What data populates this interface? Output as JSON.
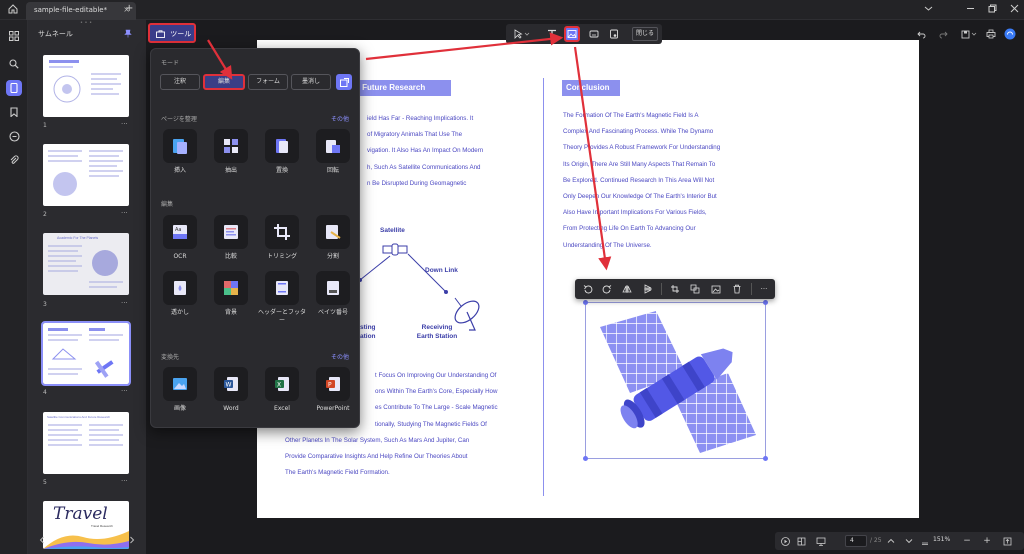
{
  "app": {
    "tab_title": "sample-file-editable*",
    "tab_close": "×",
    "new_tab": "+"
  },
  "thumbnails": {
    "panel_title": "サムネール",
    "pages": [
      {
        "num": "1",
        "more": "···"
      },
      {
        "num": "2",
        "more": "···"
      },
      {
        "num": "3",
        "more": "···"
      },
      {
        "num": "4",
        "more": "···"
      },
      {
        "num": "5",
        "more": "···"
      }
    ],
    "thumb_titles": {
      "p3": "Academic For The Planets",
      "p5": "Satellite Communications And Future Research",
      "p6_big": "Travel",
      "p6_sub": "Travel Research"
    }
  },
  "toolbar": {
    "tools_label": "ツール",
    "close_label": "閉じる"
  },
  "popup": {
    "mode": {
      "title": "モード",
      "buttons": [
        {
          "label": "注釈",
          "active": false
        },
        {
          "label": "編集",
          "active": true
        },
        {
          "label": "フォーム",
          "active": false
        },
        {
          "label": "墨消し",
          "active": false
        }
      ]
    },
    "organize": {
      "title": "ページを整理",
      "more": "その他",
      "items": [
        {
          "label": "挿入",
          "icon": "insert-pages-icon"
        },
        {
          "label": "抽出",
          "icon": "extract-pages-icon"
        },
        {
          "label": "置換",
          "icon": "replace-pages-icon"
        },
        {
          "label": "回転",
          "icon": "rotate-pages-icon"
        }
      ]
    },
    "edit": {
      "title": "編集",
      "items": [
        {
          "label": "OCR",
          "icon": "ocr-icon"
        },
        {
          "label": "比較",
          "icon": "compare-icon"
        },
        {
          "label": "トリミング",
          "icon": "crop-icon"
        },
        {
          "label": "分割",
          "icon": "split-icon"
        },
        {
          "label": "透かし",
          "icon": "watermark-icon"
        },
        {
          "label": "背景",
          "icon": "background-icon"
        },
        {
          "label": "ヘッダーとフッター",
          "icon": "header-footer-icon"
        },
        {
          "label": "ベイツ番号",
          "icon": "bates-number-icon"
        }
      ]
    },
    "convert": {
      "title": "変換先",
      "more": "その他",
      "items": [
        {
          "label": "画像",
          "icon": "image-icon",
          "color": "#4aa3f0"
        },
        {
          "label": "Word",
          "icon": "word-icon",
          "color": "#2b579a"
        },
        {
          "label": "Excel",
          "icon": "excel-icon",
          "color": "#217346"
        },
        {
          "label": "PowerPoint",
          "icon": "powerpoint-icon",
          "color": "#d24726"
        }
      ]
    }
  },
  "document": {
    "left_heading": "d Future Research",
    "left_top_lines": [
      "ield Has Far - Reaching Implications. It",
      "of Migratory Animals That Use The",
      "vigation. It Also Has An Impact On Modern",
      "h, Such As Satellite Communications And",
      "n Be Disrupted During Geomagnetic"
    ],
    "diagram": {
      "satellite": "Satellite",
      "downlink": "Down Link",
      "left_a": "sting",
      "left_b": "ation",
      "receiving_a": "Receiving",
      "receiving_b": "Earth Station"
    },
    "left_bottom_lines": [
      "t Focus On Improving Our Understanding Of",
      "ons Within The Earth's Core, Especially How",
      "es Contribute To The Large - Scale Magnetic",
      "tionally, Studying The Magnetic Fields Of",
      "Other Planets In The Solar System, Such As Mars And Jupiter, Can",
      "Provide Comparative Insights And Help Refine Our Theories About",
      "The Earth's Magnetic Field Formation."
    ],
    "right_heading": "Conclusion",
    "right_lines": [
      "The Formation Of The Earth's Magnetic Field Is A",
      "Complex And Fascinating Process. While The Dynamo",
      "Theory Provides A Robust Framework For Understanding",
      "Its Origin, There Are Still Many Aspects That Remain To",
      "Be Explored. Continued Research In This Area Will Not",
      "Only Deepen Our Knowledge Of The Earth's Interior But",
      "Also Have Important Implications For Various Fields,",
      "From Protecting Life On Earth To Advancing Our",
      "Understanding Of The Universe."
    ]
  },
  "imagebar": {
    "more": "···"
  },
  "bottombar": {
    "page_value": "4",
    "page_total": "/ 25",
    "zoom": "151%",
    "zoom_out": "−",
    "zoom_in": "+"
  },
  "colors": {
    "accent": "#6e76f5",
    "highlight_red": "#e0303a",
    "heading_bg": "#8c90ee",
    "doc_text": "#4b48c2"
  }
}
